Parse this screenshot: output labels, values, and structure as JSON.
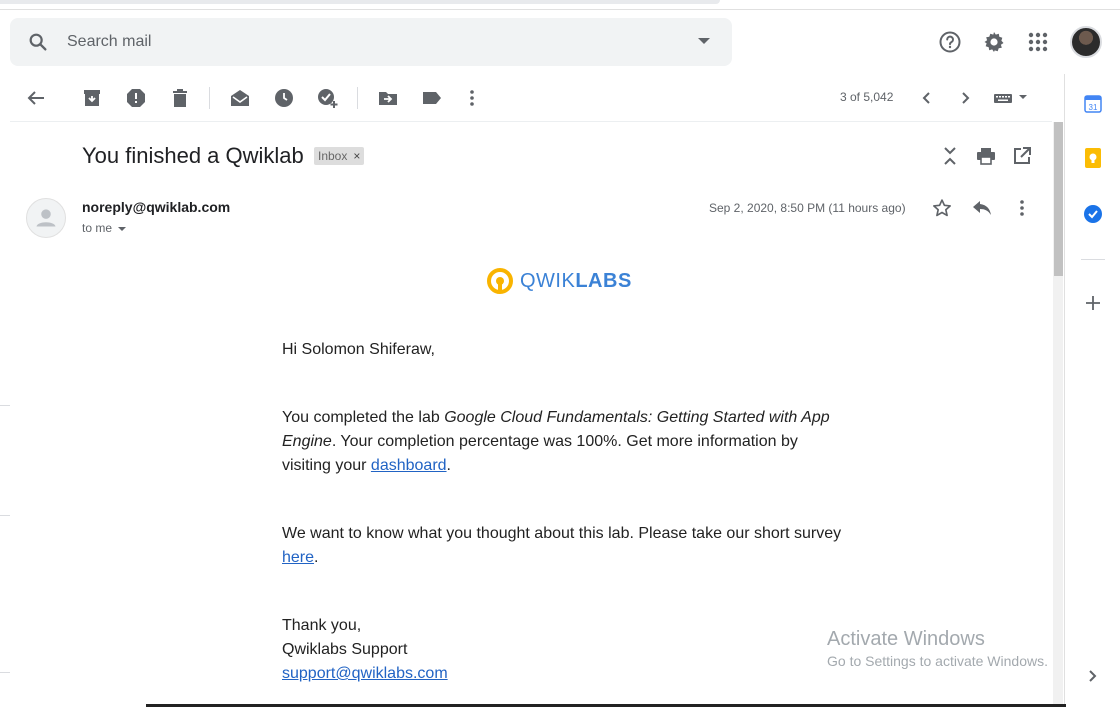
{
  "search": {
    "placeholder": "Search mail"
  },
  "toolbar": {
    "pager": "3 of 5,042"
  },
  "email": {
    "subject": "You finished a Qwiklab",
    "label": "Inbox",
    "label_close": "×",
    "sender": "noreply@qwiklab.com",
    "to": "to me",
    "date": "Sep 2, 2020, 8:50 PM (11 hours ago)",
    "logo": {
      "part1": "QWIK",
      "part2": "LABS"
    },
    "greeting": "Hi Solomon Shiferaw,",
    "p1_a": "You completed the lab ",
    "p1_lab": "Google Cloud Fundamentals: Getting Started with App Engine",
    "p1_b": ". Your completion percentage was 100%. Get more information by visiting your ",
    "p1_link": "dashboard",
    "p1_end": ".",
    "p2_a": "We want to know what you thought about this lab. Please take our short survey ",
    "p2_link": "here",
    "p2_end": ".",
    "closing": "Thank you,",
    "signature": "Qwiklabs Support",
    "support_email": "support@qwiklabs.com"
  },
  "sidepanel": {
    "calendar_day": "31"
  },
  "watermark": {
    "title": "Activate Windows",
    "subtitle": "Go to Settings to activate Windows."
  },
  "colors": {
    "accent": "#1a73e8",
    "link": "#2163c4",
    "logo_blue": "#3b82d6",
    "logo_yellow": "#f9b400"
  },
  "icons": {
    "search": "search-icon",
    "help": "help-icon",
    "settings": "gear-icon",
    "apps": "apps-grid-icon"
  }
}
